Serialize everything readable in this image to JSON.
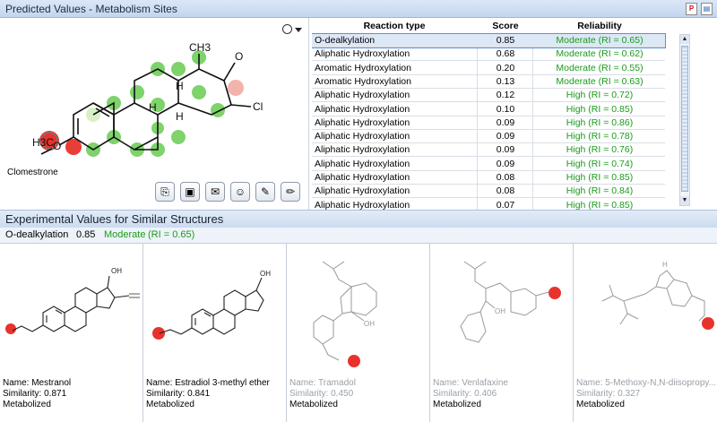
{
  "window": {
    "title": "Predicted Values - Metabolism Sites"
  },
  "molecule": {
    "name": "Clomestrone",
    "atom_labels": {
      "methyl_top": "CH3",
      "ketone": "O",
      "chlorine": "Cl",
      "methoxy": "H3C",
      "ether_o": "O",
      "h_upper": "H",
      "h_left": "H",
      "h_lower": "H"
    }
  },
  "toolbar": {
    "icons": [
      "copy-structure-icon",
      "copy-image-icon",
      "export-icon",
      "smiley-icon",
      "edit-folder-icon",
      "pencil-icon"
    ]
  },
  "table": {
    "headers": {
      "type": "Reaction type",
      "score": "Score",
      "reliability": "Reliability"
    },
    "rows": [
      {
        "type": "O-dealkylation",
        "score": "0.85",
        "reliability": "Moderate (RI = 0.65)"
      },
      {
        "type": "Aliphatic Hydroxylation",
        "score": "0.68",
        "reliability": "Moderate (RI = 0.62)"
      },
      {
        "type": "Aromatic Hydroxylation",
        "score": "0.20",
        "reliability": "Moderate (RI = 0.55)"
      },
      {
        "type": "Aromatic Hydroxylation",
        "score": "0.13",
        "reliability": "Moderate (RI = 0.63)"
      },
      {
        "type": "Aliphatic Hydroxylation",
        "score": "0.12",
        "reliability": "High (RI = 0.72)"
      },
      {
        "type": "Aliphatic Hydroxylation",
        "score": "0.10",
        "reliability": "High (RI = 0.85)"
      },
      {
        "type": "Aliphatic Hydroxylation",
        "score": "0.09",
        "reliability": "High (RI = 0.86)"
      },
      {
        "type": "Aliphatic Hydroxylation",
        "score": "0.09",
        "reliability": "High (RI = 0.78)"
      },
      {
        "type": "Aliphatic Hydroxylation",
        "score": "0.09",
        "reliability": "High (RI = 0.76)"
      },
      {
        "type": "Aliphatic Hydroxylation",
        "score": "0.09",
        "reliability": "High (RI = 0.74)"
      },
      {
        "type": "Aliphatic Hydroxylation",
        "score": "0.08",
        "reliability": "High (RI = 0.85)"
      },
      {
        "type": "Aliphatic Hydroxylation",
        "score": "0.08",
        "reliability": "High (RI = 0.84)"
      },
      {
        "type": "Aliphatic Hydroxylation",
        "score": "0.07",
        "reliability": "High (RI = 0.85)"
      }
    ]
  },
  "experimental": {
    "title": "Experimental Values for Similar Structures",
    "selected_type": "O-dealkylation",
    "selected_score": "0.85",
    "selected_reliability": "Moderate",
    "selected_ri": "(RI = 0.65)",
    "cards": [
      {
        "name": "Name: Mestranol",
        "similarity": "Similarity: 0.871",
        "status": "Metabolized",
        "labels": {
          "oh": "OH"
        }
      },
      {
        "name": "Name: Estradiol 3-methyl ether",
        "similarity": "Similarity: 0.841",
        "status": "Metabolized",
        "labels": {
          "oh": "OH"
        }
      },
      {
        "name": "Name: Tramadol",
        "similarity": "Similarity: 0.450",
        "status": "Metabolized",
        "labels": {
          "oh": "OH"
        }
      },
      {
        "name": "Name: Venlafaxine",
        "similarity": "Similarity: 0.406",
        "status": "Metabolized",
        "labels": {
          "oh": "OH"
        }
      },
      {
        "name": "Name: 5-Methoxy-N,N-diisopropy...",
        "similarity": "Similarity: 0.327",
        "status": "Metabolized",
        "labels": {
          "nh": "H"
        }
      }
    ]
  },
  "colors": {
    "site_high": "#e8332c",
    "site_green": "#7ed36b",
    "site_pink": "#f3b3ad",
    "reliability_text": "#1b9b1b"
  }
}
